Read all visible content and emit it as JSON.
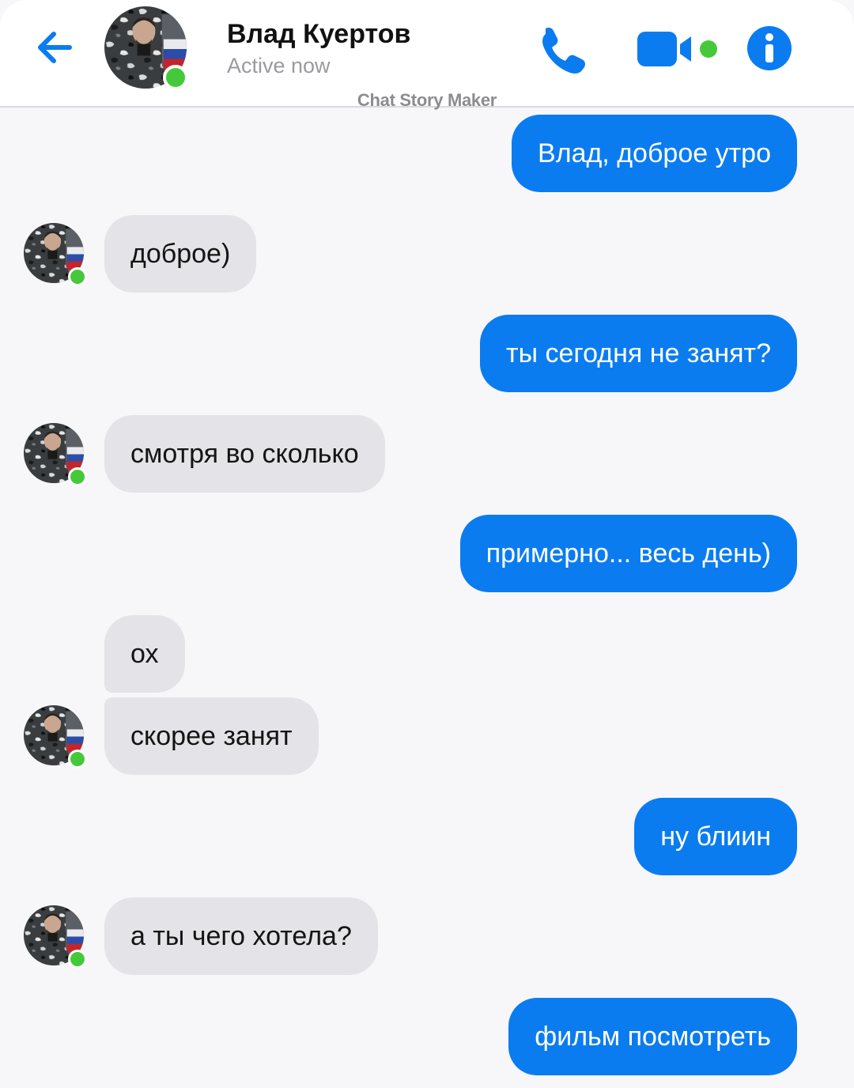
{
  "header": {
    "contact_name": "Влад Куертов",
    "status": "Active now",
    "watermark": "Chat Story Maker",
    "icons": [
      "back-arrow-icon",
      "phone-icon",
      "video-camera-icon",
      "info-icon"
    ],
    "accent_color": "#0a7cf0",
    "presence_color": "#45c93a"
  },
  "messages": [
    {
      "from": "me",
      "text": "Влад, доброе утро"
    },
    {
      "from": "contact",
      "text": "доброе)"
    },
    {
      "from": "me",
      "text": "ты сегодня не занят?"
    },
    {
      "from": "contact",
      "text": "смотря во сколько"
    },
    {
      "from": "me",
      "text": "примерно... весь день)"
    },
    {
      "from": "contact",
      "text": "ох"
    },
    {
      "from": "contact",
      "text": "скорее занят"
    },
    {
      "from": "me",
      "text": "ну блиин"
    },
    {
      "from": "contact",
      "text": "а ты чего хотела?"
    },
    {
      "from": "me",
      "text": "фильм посмотреть"
    }
  ]
}
